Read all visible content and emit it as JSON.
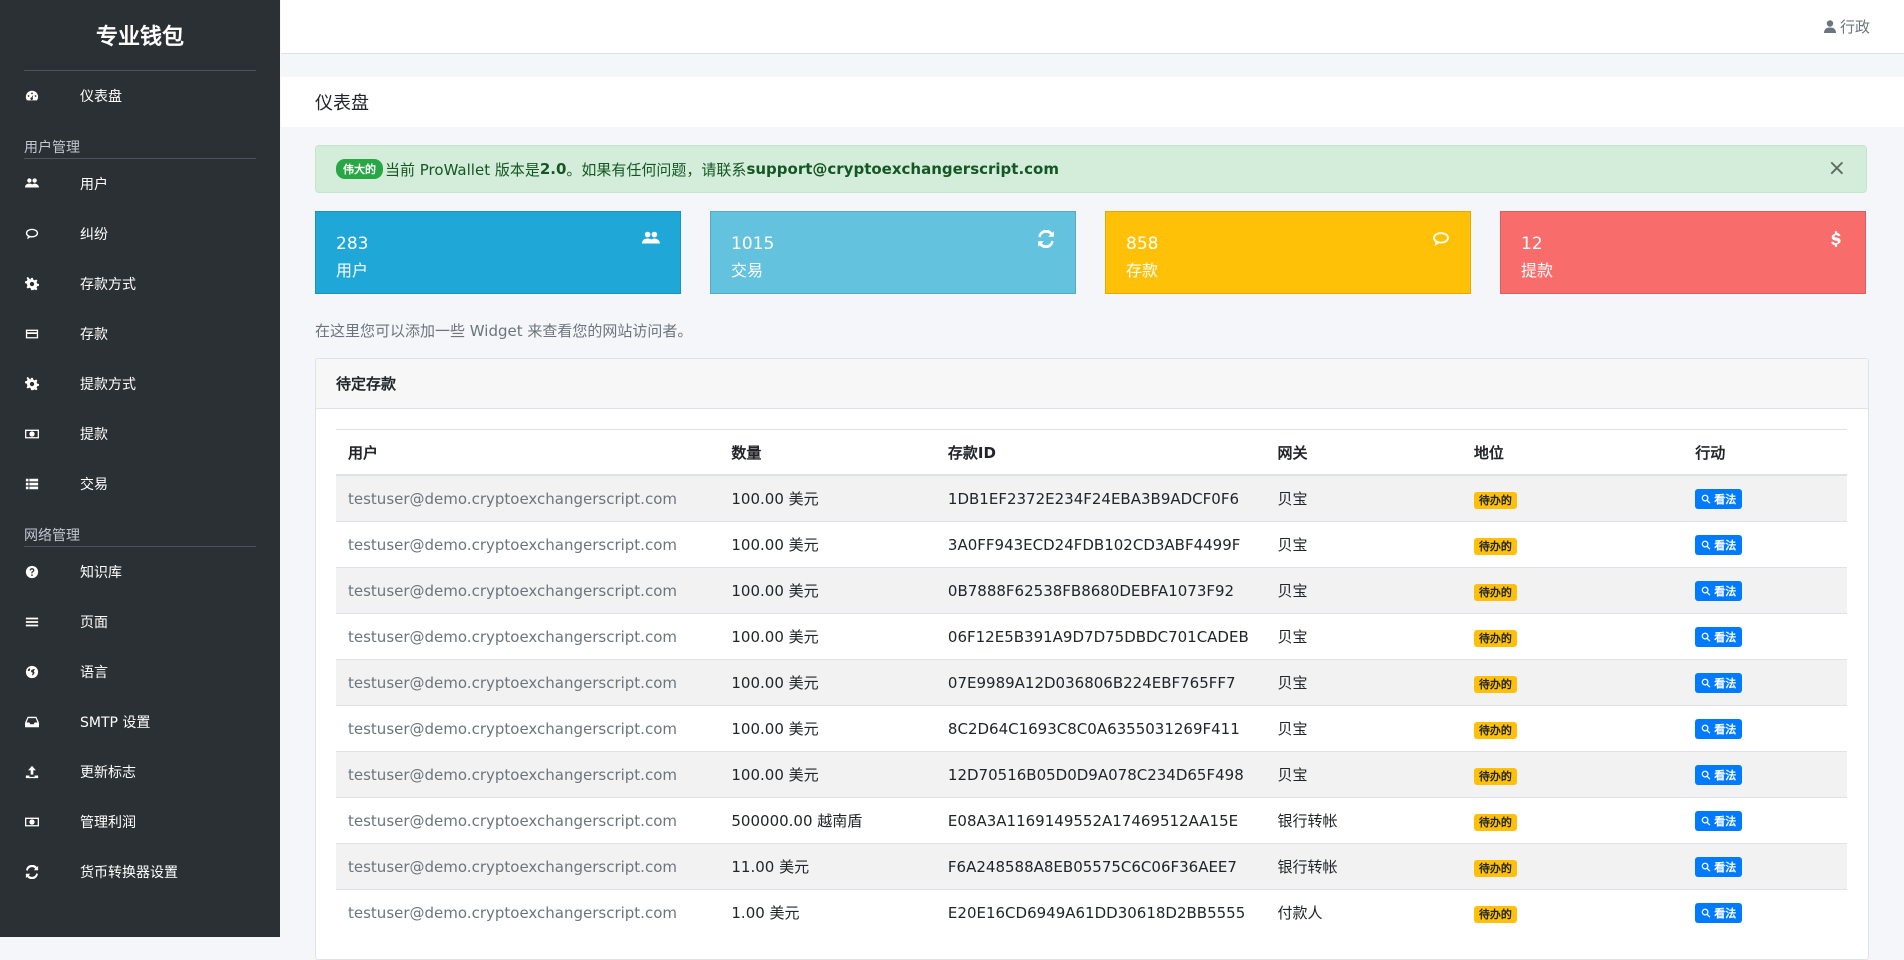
{
  "sidebar": {
    "brand": "专业钱包",
    "dashboard": "仪表盘",
    "sections": [
      {
        "header": "用户管理",
        "items": [
          {
            "label": "用户",
            "icon": "users-icon"
          },
          {
            "label": "纠纷",
            "icon": "comments-icon"
          },
          {
            "label": "存款方式",
            "icon": "cogs-icon"
          },
          {
            "label": "存款",
            "icon": "credit-card-icon"
          },
          {
            "label": "提款方式",
            "icon": "cogs-icon"
          },
          {
            "label": "提款",
            "icon": "money-icon"
          },
          {
            "label": "交易",
            "icon": "list-icon"
          }
        ]
      },
      {
        "header": "网络管理",
        "items": [
          {
            "label": "知识库",
            "icon": "question-circle-icon"
          },
          {
            "label": "页面",
            "icon": "bars-icon"
          },
          {
            "label": "语言",
            "icon": "globe-icon"
          },
          {
            "label": "SMTP 设置",
            "icon": "inbox-icon"
          },
          {
            "label": "更新标志",
            "icon": "upload-icon"
          },
          {
            "label": "管理利润",
            "icon": "money-icon"
          },
          {
            "label": "货币转换器设置",
            "icon": "refresh-icon"
          }
        ]
      }
    ]
  },
  "topbar": {
    "user": "行政"
  },
  "page_title": "仪表盘",
  "alert": {
    "badge": "伟大的",
    "text1": "当前 ProWallet 版本是",
    "version": "2.0",
    "text2": "。如果有任何问题，请联系",
    "email": "support@cryptoexchangerscript.com",
    "close": "×"
  },
  "stats": [
    {
      "value": "283",
      "label": "用户",
      "icon": "users-icon",
      "color": "#1fa7d8"
    },
    {
      "value": "1015",
      "label": "交易",
      "icon": "refresh-icon",
      "color": "#63c2de"
    },
    {
      "value": "858",
      "label": "存款",
      "icon": "comments-icon",
      "color": "#ffc107"
    },
    {
      "value": "12",
      "label": "提款",
      "icon": "dollar-icon",
      "color": "#f86c6b"
    }
  ],
  "info_text": "在这里您可以添加一些 Widget 来查看您的网站访问者。",
  "pending_card": {
    "title": "待定存款",
    "columns": [
      "用户",
      "数量",
      "存款ID",
      "网关",
      "地位",
      "行动"
    ],
    "rows": [
      [
        "testuser@demo.cryptoexchangerscript.com",
        "100.00 美元",
        "1DB1EF2372E234F24EBA3B9ADCF0F6",
        "贝宝",
        "待办的",
        "看法"
      ],
      [
        "testuser@demo.cryptoexchangerscript.com",
        "100.00 美元",
        "3A0FF943ECD24FDB102CD3ABF4499F",
        "贝宝",
        "待办的",
        "看法"
      ],
      [
        "testuser@demo.cryptoexchangerscript.com",
        "100.00 美元",
        "0B7888F62538FB8680DEBFA1073F92",
        "贝宝",
        "待办的",
        "看法"
      ],
      [
        "testuser@demo.cryptoexchangerscript.com",
        "100.00 美元",
        "06F12E5B391A9D7D75DBDC701CADEB",
        "贝宝",
        "待办的",
        "看法"
      ],
      [
        "testuser@demo.cryptoexchangerscript.com",
        "100.00 美元",
        "07E9989A12D036806B224EBF765FF7",
        "贝宝",
        "待办的",
        "看法"
      ],
      [
        "testuser@demo.cryptoexchangerscript.com",
        "100.00 美元",
        "8C2D64C1693C8C0A6355031269F411",
        "贝宝",
        "待办的",
        "看法"
      ],
      [
        "testuser@demo.cryptoexchangerscript.com",
        "100.00 美元",
        "12D70516B05D0D9A078C234D65F498",
        "贝宝",
        "待办的",
        "看法"
      ],
      [
        "testuser@demo.cryptoexchangerscript.com",
        "500000.00 越南盾",
        "E08A3A1169149552A17469512AA15E",
        "银行转帐",
        "待办的",
        "看法"
      ],
      [
        "testuser@demo.cryptoexchangerscript.com",
        "11.00 美元",
        "F6A248588A8EB05575C6C06F36AEE7",
        "银行转帐",
        "待办的",
        "看法"
      ],
      [
        "testuser@demo.cryptoexchangerscript.com",
        "1.00 美元",
        "E20E16CD6949A61DD30618D2BB5555",
        "付款人",
        "待办的",
        "看法"
      ]
    ]
  }
}
